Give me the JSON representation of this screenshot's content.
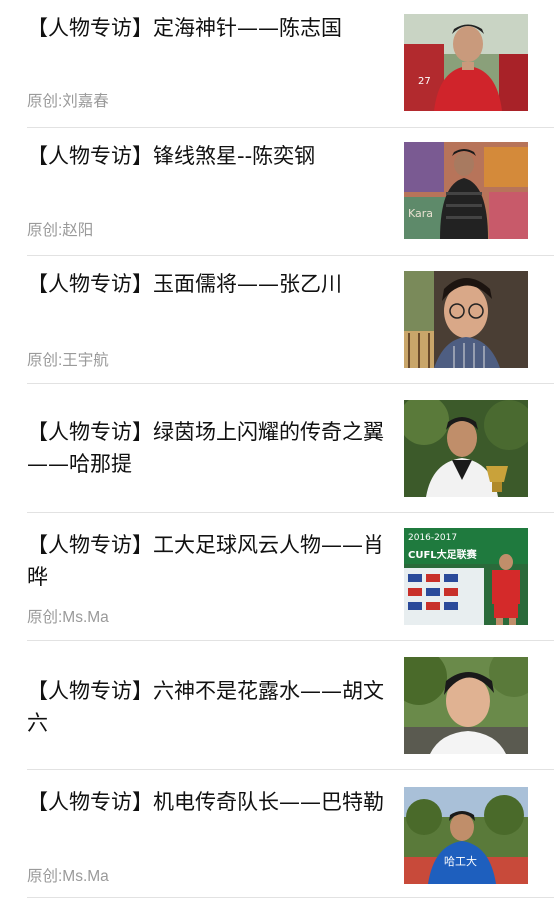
{
  "articles": [
    {
      "title": "【人物专访】定海神针——陈志国",
      "author": "原创:刘嘉春",
      "thumb": "soccer-player-red-jersey-photo"
    },
    {
      "title": "【人物专访】锋线煞星--陈奕钢",
      "author": "原创:赵阳",
      "thumb": "man-graffiti-wall-photo"
    },
    {
      "title": "【人物专访】玉面儒将——张乙川",
      "author": "原创:王宇航",
      "thumb": "young-man-glasses-photo"
    },
    {
      "title": "【人物专访】绿茵场上闪耀的传奇之翼——哈那提",
      "author": "",
      "thumb": "man-with-trophy-photo"
    },
    {
      "title": "【人物专访】工大足球风云人物——肖晔",
      "author": "原创:Ms.Ma",
      "thumb": "cufl-banner-player-photo"
    },
    {
      "title": "【人物专访】六神不是花露水——胡文六",
      "author": "",
      "thumb": "young-man-trees-photo"
    },
    {
      "title": "【人物专访】机电传奇队长——巴特勒",
      "author": "原创:Ms.Ma",
      "thumb": "player-blue-jersey-photo"
    }
  ],
  "banner_text": {
    "years": "2016-2017",
    "league": "CUFL大足联赛"
  },
  "jersey_text": "哈工大"
}
